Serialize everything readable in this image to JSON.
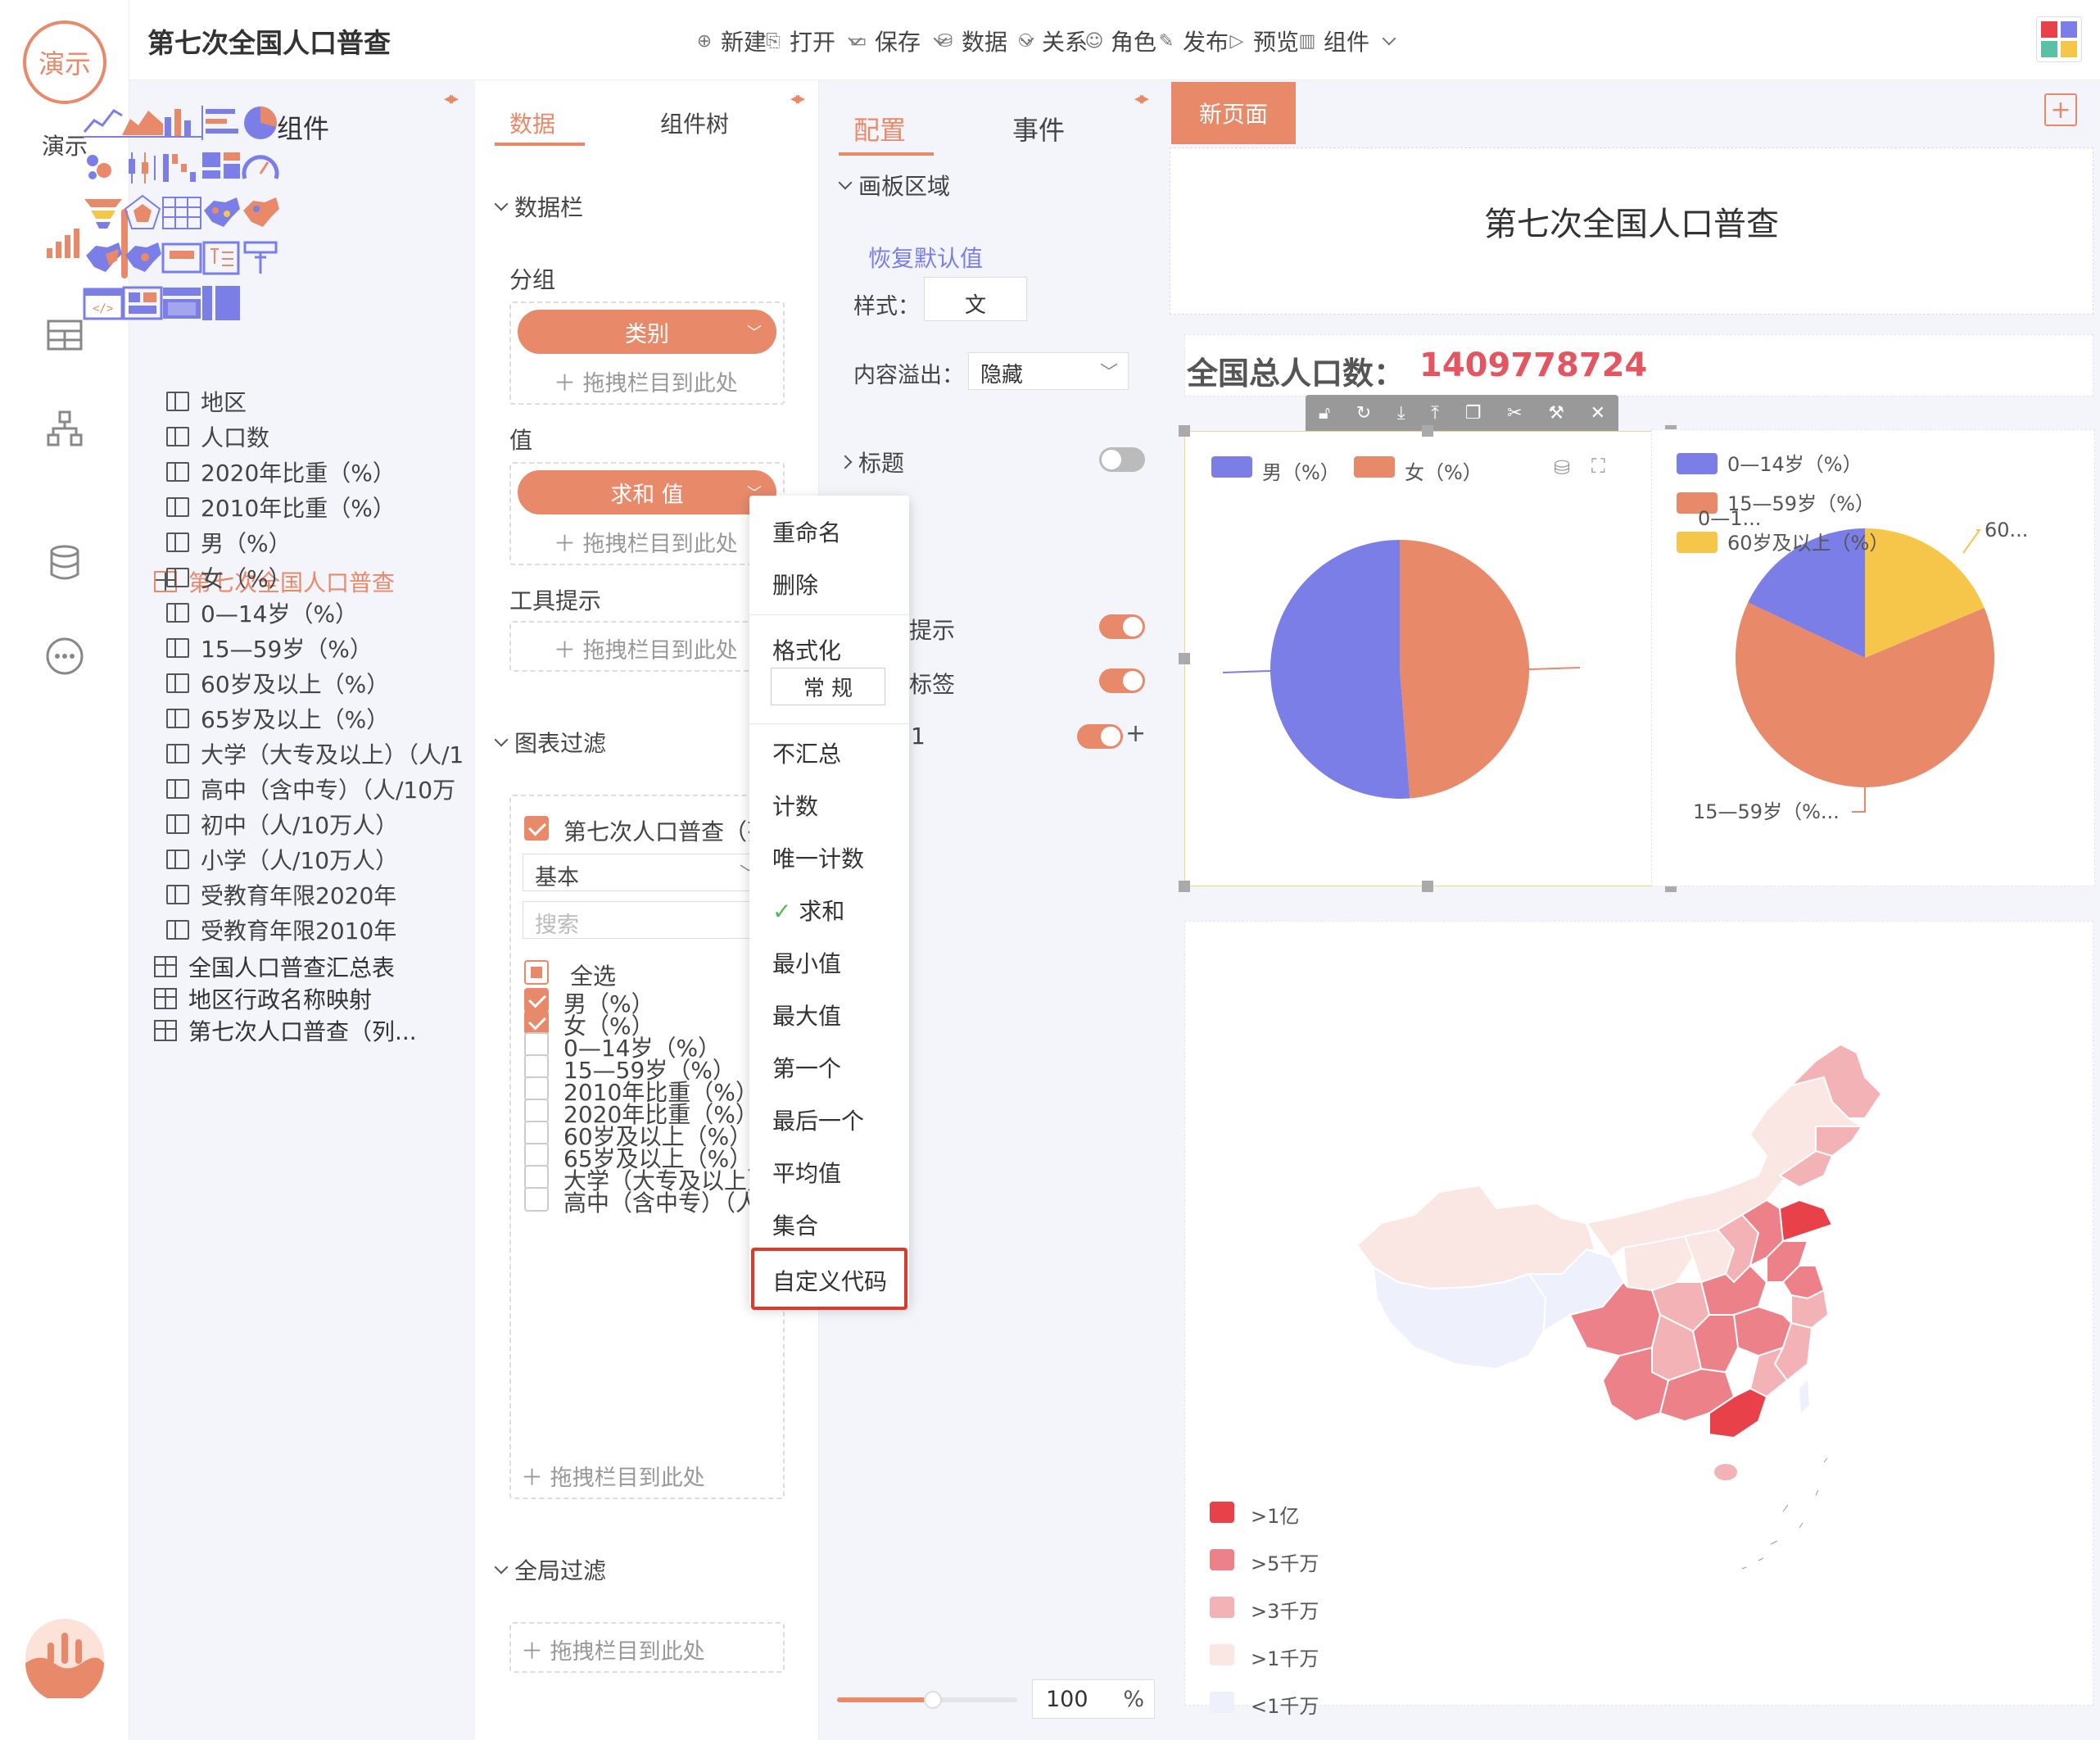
{
  "app": {
    "logo_text": "演示",
    "logo_label": "演示",
    "title": "第七次全国人口普查"
  },
  "toolbar": [
    {
      "label": "新建",
      "icon": "plus-circle-icon",
      "caret": false
    },
    {
      "label": "打开",
      "icon": "open-icon",
      "caret": true
    },
    {
      "label": "保存",
      "icon": "save-icon",
      "caret": true
    },
    {
      "label": "数据",
      "icon": "database-icon",
      "caret": true
    },
    {
      "label": "关系",
      "icon": "relation-icon",
      "caret": false
    },
    {
      "label": "角色",
      "icon": "role-icon",
      "caret": false
    },
    {
      "label": "发布",
      "icon": "publish-icon",
      "caret": false
    },
    {
      "label": "预览",
      "icon": "preview-icon",
      "caret": false
    },
    {
      "label": "组件",
      "icon": "chart-icon",
      "caret": true
    }
  ],
  "components_panel": {
    "title": "组件",
    "dataset_title": "第七次全国人口普查",
    "fields": [
      "地区",
      "人口数",
      "2020年比重（%）",
      "2010年比重（%）",
      "男（%）",
      "女（%）",
      "0—14岁（%）",
      "15—59岁（%）",
      "60岁及以上（%）",
      "65岁及以上（%）",
      "大学（大专及以上）（人/1",
      "高中（含中专）（人/10万",
      "初中（人/10万人）",
      "小学（人/10万人）",
      "受教育年限2020年",
      "受教育年限2010年"
    ],
    "other_tables": [
      "全国人口普查汇总表",
      "地区行政名称映射",
      "第七次人口普查（列..."
    ]
  },
  "data_panel": {
    "tabs": [
      "数据",
      "组件树"
    ],
    "section_datacol": "数据栏",
    "group_label": "分组",
    "group_pill": "类别",
    "value_label": "值",
    "value_pill": "求和 值",
    "tooltip_label": "工具提示",
    "drop_hint": "拖拽栏目到此处",
    "chart_filter": "图表过滤",
    "filter_dataset": "第七次人口普查（列",
    "filter_mode": "基本",
    "filter_search_placeholder": "搜索",
    "select_all": "全选",
    "filter_items": [
      {
        "label": "男（%）",
        "checked": true
      },
      {
        "label": "女（%）",
        "checked": true
      },
      {
        "label": "0—14岁（%）",
        "checked": false
      },
      {
        "label": "15—59岁（%）",
        "checked": false
      },
      {
        "label": "2010年比重（%）",
        "checked": false
      },
      {
        "label": "2020年比重（%）",
        "checked": false
      },
      {
        "label": "60岁及以上（%）",
        "checked": false
      },
      {
        "label": "65岁及以上（%）",
        "checked": false
      },
      {
        "label": "大学（大专及以上）",
        "checked": false
      },
      {
        "label": "高中（含中专）（人",
        "checked": false
      }
    ],
    "global_filter": "全局过滤"
  },
  "context_menu": {
    "rename": "重命名",
    "delete": "删除",
    "format": "格式化",
    "format_value": "常 规",
    "aggregations": [
      "不汇总",
      "计数",
      "唯一计数",
      "求和",
      "最小值",
      "最大值",
      "第一个",
      "最后一个",
      "平均值",
      "集合"
    ],
    "selected_agg": "求和",
    "custom_code": "自定义代码"
  },
  "config_panel": {
    "tabs": [
      "配置",
      "事件"
    ],
    "canvas_area": "画板区域",
    "restore_default": "恢复默认值",
    "style_label": "样式：",
    "style_value": "文",
    "overflow_label": "内容溢出：",
    "overflow_value": "隐藏",
    "title_label": "标题",
    "tooltip_label": "提示",
    "label_label": "标签",
    "row_prefix": "1",
    "zoom_value": "100",
    "zoom_unit": "%"
  },
  "canvas": {
    "page_tab": "新页面",
    "report_title": "第七次全国人口普查",
    "total_label": "全国总人口数：",
    "total_value": "1409778724",
    "pie1_legend": [
      "男（%）",
      "女（%）"
    ],
    "pie2_legend": [
      "0—14岁（%）",
      "15—59岁（%）",
      "60岁及以上（%）"
    ],
    "pie2_labels": [
      "0—1...",
      "60...",
      "15—59岁（%..."
    ],
    "map_legend": [
      ">1亿",
      ">5千万",
      ">3千万",
      ">1千万",
      "<1千万"
    ]
  },
  "colors": {
    "accent": "#e8896a",
    "blue": "#7b7ee6",
    "orange": "#e8896a",
    "yellow": "#f5c64a",
    "highlight": "#e0382b",
    "map": [
      "#e8414a",
      "#ed8189",
      "#f3b2b6",
      "#fae6e3",
      "#eef0fb"
    ]
  },
  "chart_data": [
    {
      "type": "pie",
      "title": "",
      "series": [
        {
          "name": "男（%）",
          "value": 51.24
        },
        {
          "name": "女（%）",
          "value": 48.76
        }
      ]
    },
    {
      "type": "pie",
      "title": "",
      "series": [
        {
          "name": "0—14岁（%）",
          "value": 17.95
        },
        {
          "name": "15—59岁（%）",
          "value": 63.35
        },
        {
          "name": "60岁及以上（%）",
          "value": 18.7
        }
      ]
    }
  ]
}
